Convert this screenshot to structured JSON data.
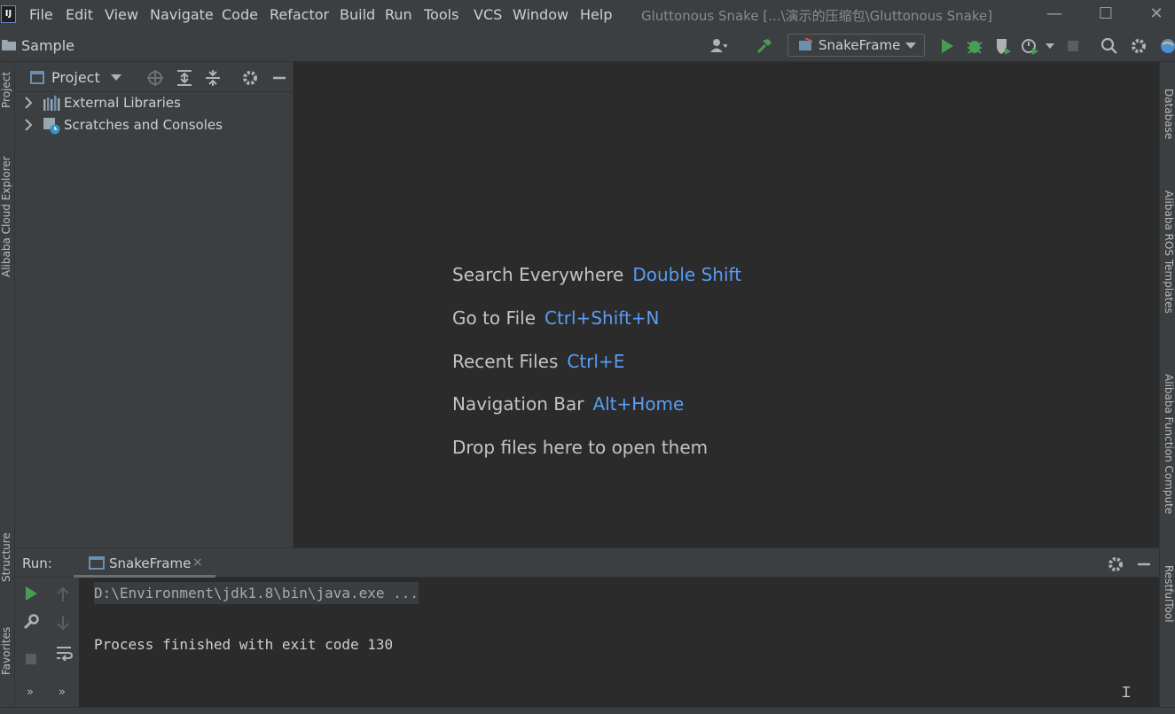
{
  "app_icon_text": "IJ",
  "menu": [
    "File",
    "Edit",
    "View",
    "Navigate",
    "Code",
    "Refactor",
    "Build",
    "Run",
    "Tools",
    "VCS",
    "Window",
    "Help"
  ],
  "window_title": "Gluttonous Snake [...\\演示的压缩包\\Gluttonous Snake]",
  "window_controls": {
    "minimize": "—",
    "maximize": "☐",
    "close": "✕"
  },
  "breadcrumb": "Sample",
  "run_config": "SnakeFrame",
  "left_stripe": [
    "Project",
    "Alibaba Cloud Explorer",
    "Structure",
    "Favorites"
  ],
  "right_stripe": [
    "Database",
    "Alibaba ROS Templates",
    "Alibaba Function Compute",
    "RestfulTool"
  ],
  "project_panel": {
    "title": "Project",
    "items": [
      {
        "label": "External Libraries",
        "icon": "libraries-icon"
      },
      {
        "label": "Scratches and Consoles",
        "icon": "scratches-icon"
      }
    ]
  },
  "editor_hints": [
    {
      "action": "Search Everywhere",
      "key": "Double Shift"
    },
    {
      "action": "Go to File",
      "key": "Ctrl+Shift+N"
    },
    {
      "action": "Recent Files",
      "key": "Ctrl+E"
    },
    {
      "action": "Navigation Bar",
      "key": "Alt+Home"
    },
    {
      "action": "Drop files here to open them",
      "key": ""
    }
  ],
  "run_panel": {
    "label": "Run:",
    "tab": "SnakeFrame",
    "tab_close": "×",
    "console": [
      "D:\\Environment\\jdk1.8\\bin\\java.exe ...",
      "Process finished with exit code 130"
    ]
  },
  "colors": {
    "accent_key": "#589df6",
    "run_green": "#499c54",
    "bg_dark": "#2b2b2b",
    "bg_panel": "#3c3f41"
  }
}
